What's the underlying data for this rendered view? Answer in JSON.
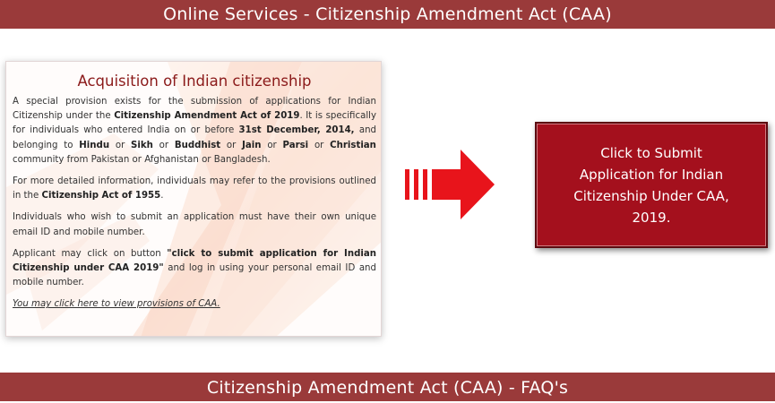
{
  "header": {
    "title": "Online Services - Citizenship Amendment Act (CAA)"
  },
  "card": {
    "title": "Acquisition of Indian citizenship",
    "p1": {
      "t1": "A special provision exists for the submission of applications for Indian Citizenship under the ",
      "b1": "Citizenship Amendment Act of 2019",
      "t2": ". It is specifically for individuals who entered India on or before ",
      "b2": "31st December, 2014,",
      "t3": " and belonging to ",
      "b3": "Hindu",
      "t4": " or ",
      "b4": "Sikh",
      "t5": " or ",
      "b5": "Buddhist",
      "t6": " or ",
      "b6": "Jain",
      "t7": " or ",
      "b7": "Parsi",
      "t8": " or ",
      "b8": "Christian",
      "t9": " community from Pakistan or Afghanistan or Bangladesh."
    },
    "p2": {
      "t1": "For more detailed information, individuals may refer to the provisions outlined in the ",
      "b1": "Citizenship Act of 1955",
      "t2": "."
    },
    "p3": "Individuals who wish to submit an application must have their own unique email ID and mobile number.",
    "p4": {
      "t1": "Applicant may click on button ",
      "b1": "\"click to submit application for Indian Citizenship under CAA 2019\"",
      "t2": " and log in using your personal email ID and mobile number."
    },
    "link": "You may click here to view provisions of CAA."
  },
  "arrow": {
    "icon": "right-arrow-icon",
    "color": "#e8141b"
  },
  "submit_button": {
    "label": "Click to Submit Application for Indian Citizenship Under CAA, 2019."
  },
  "footer": {
    "title": "Citizenship Amendment Act (CAA) - FAQ's"
  },
  "colors": {
    "bar": "#9a3a3a",
    "button": "#a4101d",
    "title": "#8b1a1a"
  }
}
